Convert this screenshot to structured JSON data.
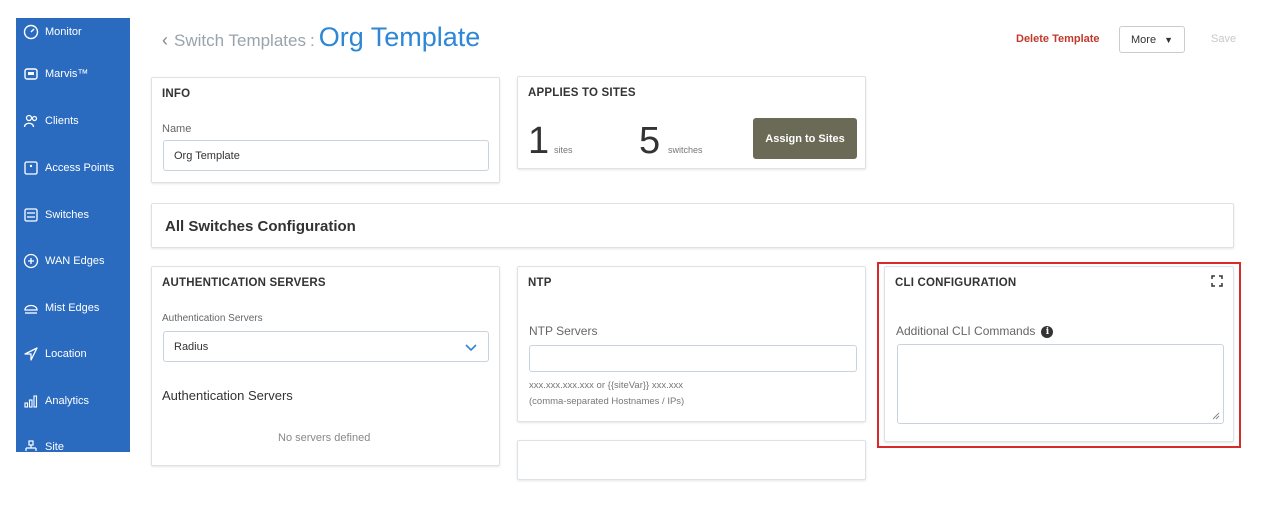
{
  "sidebar": {
    "items": [
      {
        "label": "Monitor",
        "icon": "monitor-icon"
      },
      {
        "label": "Marvis™",
        "icon": "marvis-icon"
      },
      {
        "label": "Clients",
        "icon": "clients-icon"
      },
      {
        "label": "Access Points",
        "icon": "access-point-icon"
      },
      {
        "label": "Switches",
        "icon": "switch-icon"
      },
      {
        "label": "WAN Edges",
        "icon": "wan-edge-icon"
      },
      {
        "label": "Mist Edges",
        "icon": "mist-edge-icon"
      },
      {
        "label": "Location",
        "icon": "location-icon"
      },
      {
        "label": "Analytics",
        "icon": "analytics-icon"
      },
      {
        "label": "Site",
        "icon": "site-icon"
      }
    ]
  },
  "header": {
    "breadcrumb_parent": "Switch Templates",
    "separator": ":",
    "title": "Org Template",
    "delete_label": "Delete Template",
    "more_label": "More",
    "save_label": "Save"
  },
  "info": {
    "title": "INFO",
    "name_label": "Name",
    "name_value": "Org Template"
  },
  "applies": {
    "title": "APPLIES TO SITES",
    "sites_count": "1",
    "sites_label": "sites",
    "switches_count": "5",
    "switches_label": "switches",
    "assign_label": "Assign to Sites"
  },
  "all_switches": {
    "title": "All Switches Configuration"
  },
  "auth": {
    "title": "AUTHENTICATION SERVERS",
    "select_label": "Authentication Servers",
    "select_value": "Radius",
    "section_heading": "Authentication Servers",
    "empty_text": "No servers defined"
  },
  "ntp": {
    "title": "NTP",
    "servers_label": "NTP Servers",
    "servers_value": "",
    "hint_line1": "xxx.xxx.xxx.xxx or {{siteVar}} xxx.xxx",
    "hint_line2": "(comma-separated Hostnames / IPs)"
  },
  "cli": {
    "title": "CLI CONFIGURATION",
    "commands_label": "Additional CLI Commands",
    "commands_value": "",
    "info_glyph": "i"
  },
  "colors": {
    "sidebar": "#2a6bc0",
    "title": "#2d86d6",
    "delete": "#c0392b",
    "assign_button": "#6b6a57",
    "highlight": "#d62b2b"
  }
}
